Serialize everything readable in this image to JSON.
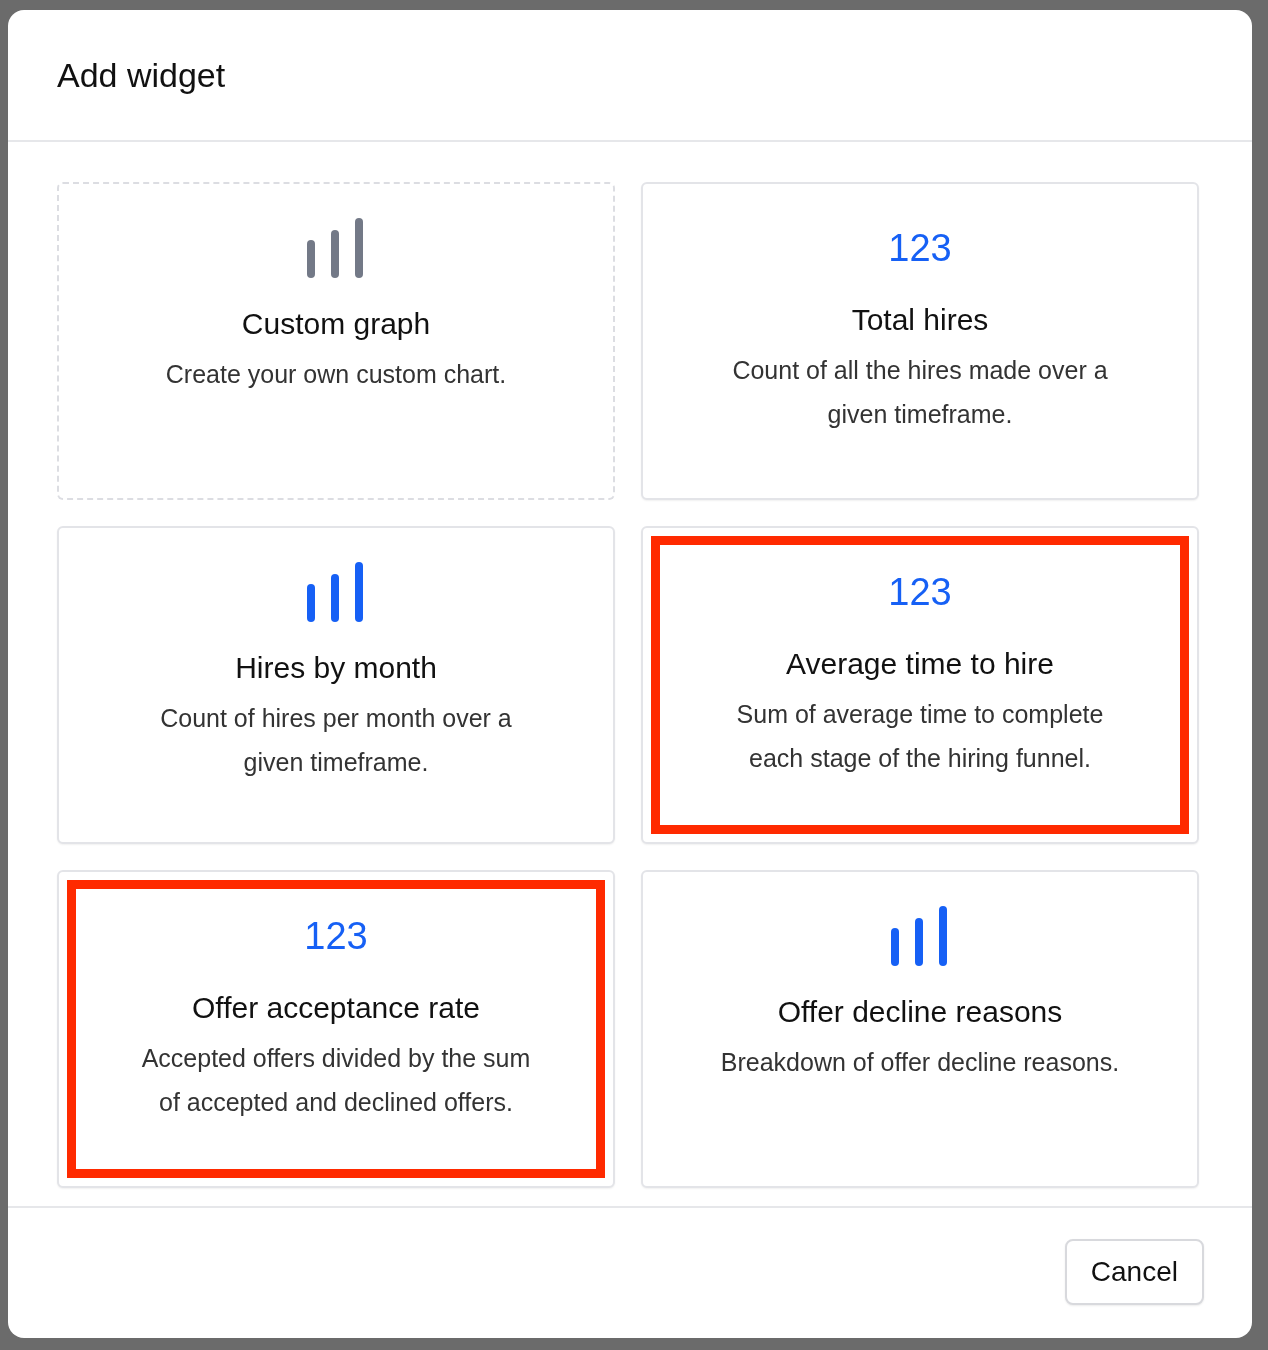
{
  "dialog": {
    "title": "Add widget"
  },
  "widgets": [
    {
      "kind": "custom",
      "title": "Custom graph",
      "description": "Create your own custom chart.",
      "highlighted": false
    },
    {
      "kind": "number",
      "icon_text": "123",
      "title": "Total hires",
      "description": "Count of all the hires made over a given timeframe.",
      "highlighted": false
    },
    {
      "kind": "bars",
      "title": "Hires by month",
      "description": "Count of hires per month over a given timeframe.",
      "highlighted": false
    },
    {
      "kind": "number",
      "icon_text": "123",
      "title": "Average time to hire",
      "description": "Sum of average time to complete each stage of the hiring funnel.",
      "highlighted": true
    },
    {
      "kind": "number",
      "icon_text": "123",
      "title": "Offer acceptance rate",
      "description": "Accepted offers divided by the sum of accepted and declined offers.",
      "highlighted": true
    },
    {
      "kind": "bars",
      "title": "Offer decline reasons",
      "description": "Breakdown of offer decline reasons.",
      "highlighted": false
    }
  ],
  "footer": {
    "cancel": "Cancel"
  }
}
